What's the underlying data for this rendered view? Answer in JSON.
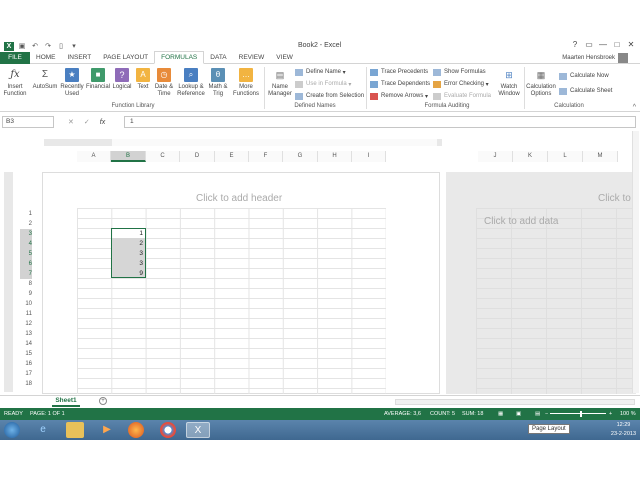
{
  "window": {
    "title": "Book2 - Excel",
    "help": "?",
    "controls": [
      "▭",
      "—",
      "□",
      "✕"
    ]
  },
  "tabs": [
    "FILE",
    "HOME",
    "INSERT",
    "PAGE LAYOUT",
    "FORMULAS",
    "DATA",
    "REVIEW",
    "VIEW"
  ],
  "active_tab": "FORMULAS",
  "user": "Maarten Hensbroek",
  "ribbon": {
    "function_library": {
      "label": "Function Library",
      "insert_function": [
        "Insert",
        "Function"
      ],
      "autosum": "AutoSum",
      "recently_used": [
        "Recently",
        "Used"
      ],
      "financial": "Financial",
      "logical": "Logical",
      "text": "Text",
      "date_time": [
        "Date &",
        "Time"
      ],
      "lookup_reference": [
        "Lookup &",
        "Reference"
      ],
      "math_trig": [
        "Math &",
        "Trig"
      ],
      "more_functions": [
        "More",
        "Functions"
      ]
    },
    "defined_names": {
      "label": "Defined Names",
      "name_manager": [
        "Name",
        "Manager"
      ],
      "define_name": "Define Name",
      "use_in_formula": "Use in Formula",
      "create_from_selection": "Create from Selection"
    },
    "formula_auditing": {
      "label": "Formula Auditing",
      "trace_precedents": "Trace Precedents",
      "trace_dependents": "Trace Dependents",
      "remove_arrows": "Remove Arrows",
      "show_formulas": "Show Formulas",
      "error_checking": "Error Checking",
      "evaluate_formula": "Evaluate Formula",
      "watch_window": [
        "Watch",
        "Window"
      ]
    },
    "calculation": {
      "label": "Calculation",
      "calculation_options": [
        "Calculation",
        "Options"
      ],
      "calculate_now": "Calculate Now",
      "calculate_sheet": "Calculate Sheet"
    }
  },
  "formula_bar": {
    "name_box": "B3",
    "cancel": "✕",
    "enter": "✓",
    "fx": "fx",
    "value": "1"
  },
  "columns_left": [
    "A",
    "B",
    "C",
    "D",
    "E",
    "F",
    "G",
    "H",
    "I"
  ],
  "columns_right": [
    "J",
    "K",
    "L",
    "M"
  ],
  "rows": [
    "1",
    "2",
    "3",
    "4",
    "5",
    "6",
    "7",
    "8",
    "9",
    "10",
    "11",
    "12",
    "13",
    "14",
    "15",
    "16",
    "17",
    "18"
  ],
  "selected_column": "B",
  "cells": [
    "1",
    "2",
    "3",
    "3",
    "9"
  ],
  "placeholders": {
    "header": "Click to add header",
    "header_right": "Click to",
    "data": "Click to add data"
  },
  "sheet_tab": "Sheet1",
  "add_sheet": "+",
  "status": {
    "ready": "READY",
    "page": "PAGE: 1 OF 1",
    "average": "AVERAGE: 3,6",
    "count": "COUNT: 5",
    "sum": "SUM: 18",
    "zoom": "100 %"
  },
  "taskbar": {
    "time": "12:29",
    "date": "23-2-2013",
    "tooltip": "Page Layout"
  },
  "colors": {
    "excel_green": "#217346",
    "taskbar": "#4a76a0"
  }
}
